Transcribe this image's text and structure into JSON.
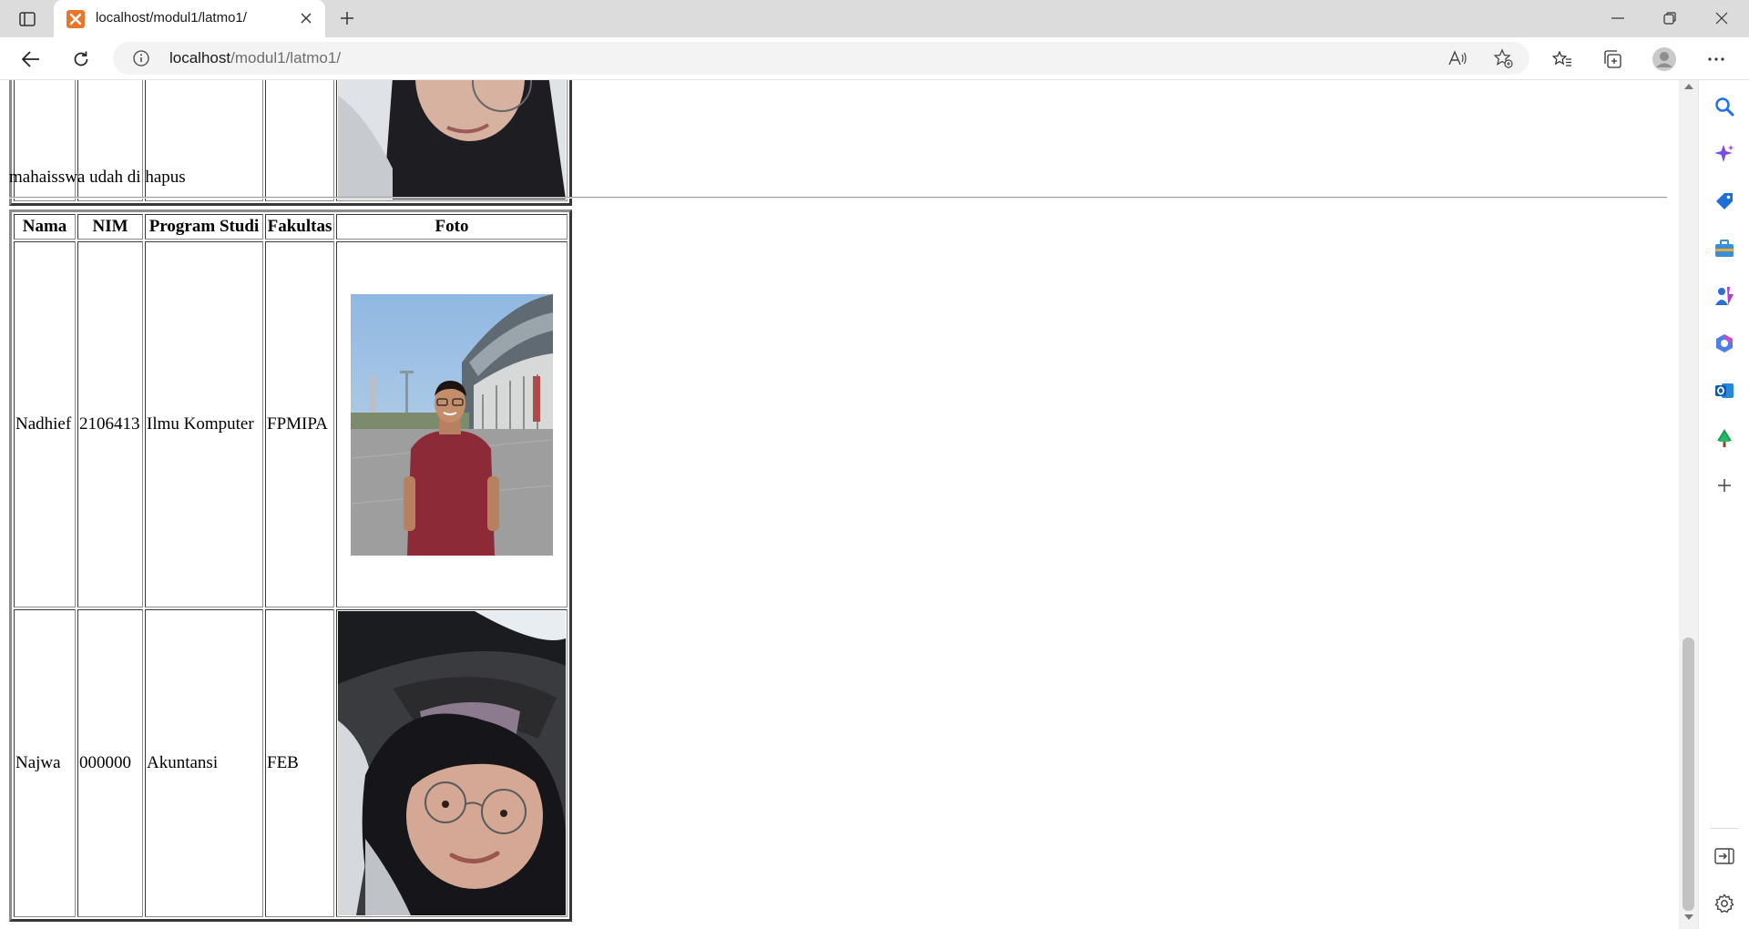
{
  "browser": {
    "tab_title": "localhost/modul1/latmo1/",
    "url_host": "localhost",
    "url_path": "/modul1/latmo1/"
  },
  "page": {
    "notice": "mahaisswa udah di hapus",
    "table": {
      "headers": [
        "Nama",
        "NIM",
        "Program Studi",
        "Fakultas",
        "Foto"
      ],
      "rows": [
        {
          "nama": "Nadhief",
          "nim": "2106413",
          "prodi": "Ilmu Komputer",
          "fakultas": "FPMIPA",
          "foto": "portrait-man-red-shirt-stadium"
        },
        {
          "nama": "Najwa",
          "nim": "000000",
          "prodi": "Akuntansi",
          "fakultas": "FEB",
          "foto": "selfie-woman-hijab-glasses-car"
        }
      ]
    }
  },
  "icons": {
    "sidebar": [
      "search-icon",
      "copilot-icon",
      "shopping-tag-icon",
      "tools-briefcase-icon",
      "games-icon",
      "microsoft365-icon",
      "outlook-icon",
      "tree-icon",
      "add-icon",
      "hide-sidebar-icon",
      "settings-icon"
    ]
  },
  "colors": {
    "tab_strip": "#dcdcdc",
    "favicon": "#e8762d",
    "search_blue": "#1a73e8"
  }
}
